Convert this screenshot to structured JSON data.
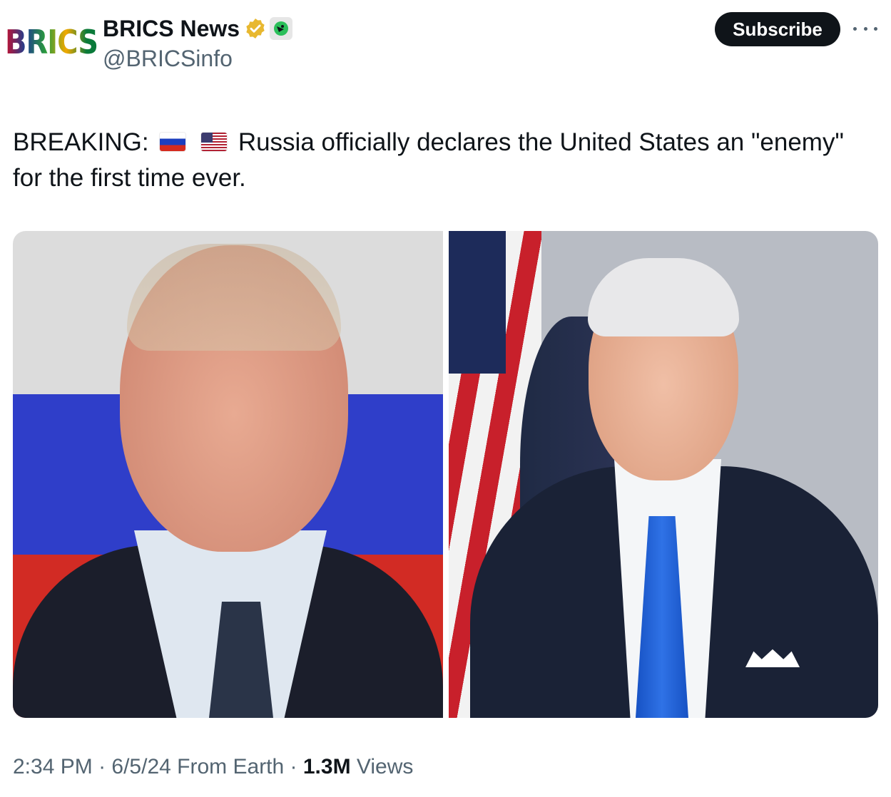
{
  "author": {
    "avatar_text": "BRICS",
    "display_name": "BRICS News",
    "handle": "@BRICSinfo"
  },
  "actions": {
    "subscribe_label": "Subscribe"
  },
  "tweet": {
    "prefix": "BREAKING:",
    "flags": [
      "russia-flag-icon",
      "usa-flag-icon"
    ],
    "body": "Russia officially declares the United States an \"enemy\" for the first time ever."
  },
  "media": {
    "images": [
      {
        "subject": "portrait-with-russian-flag"
      },
      {
        "subject": "portrait-with-american-flag"
      }
    ]
  },
  "meta": {
    "time": "2:34 PM",
    "date": "6/5/24",
    "source": "From Earth",
    "views_count": "1.3M",
    "views_label": "Views"
  },
  "colors": {
    "text_primary": "#0f1419",
    "text_secondary": "#536471",
    "button_bg": "#0f1419",
    "verified_gold": "#e8b830"
  }
}
